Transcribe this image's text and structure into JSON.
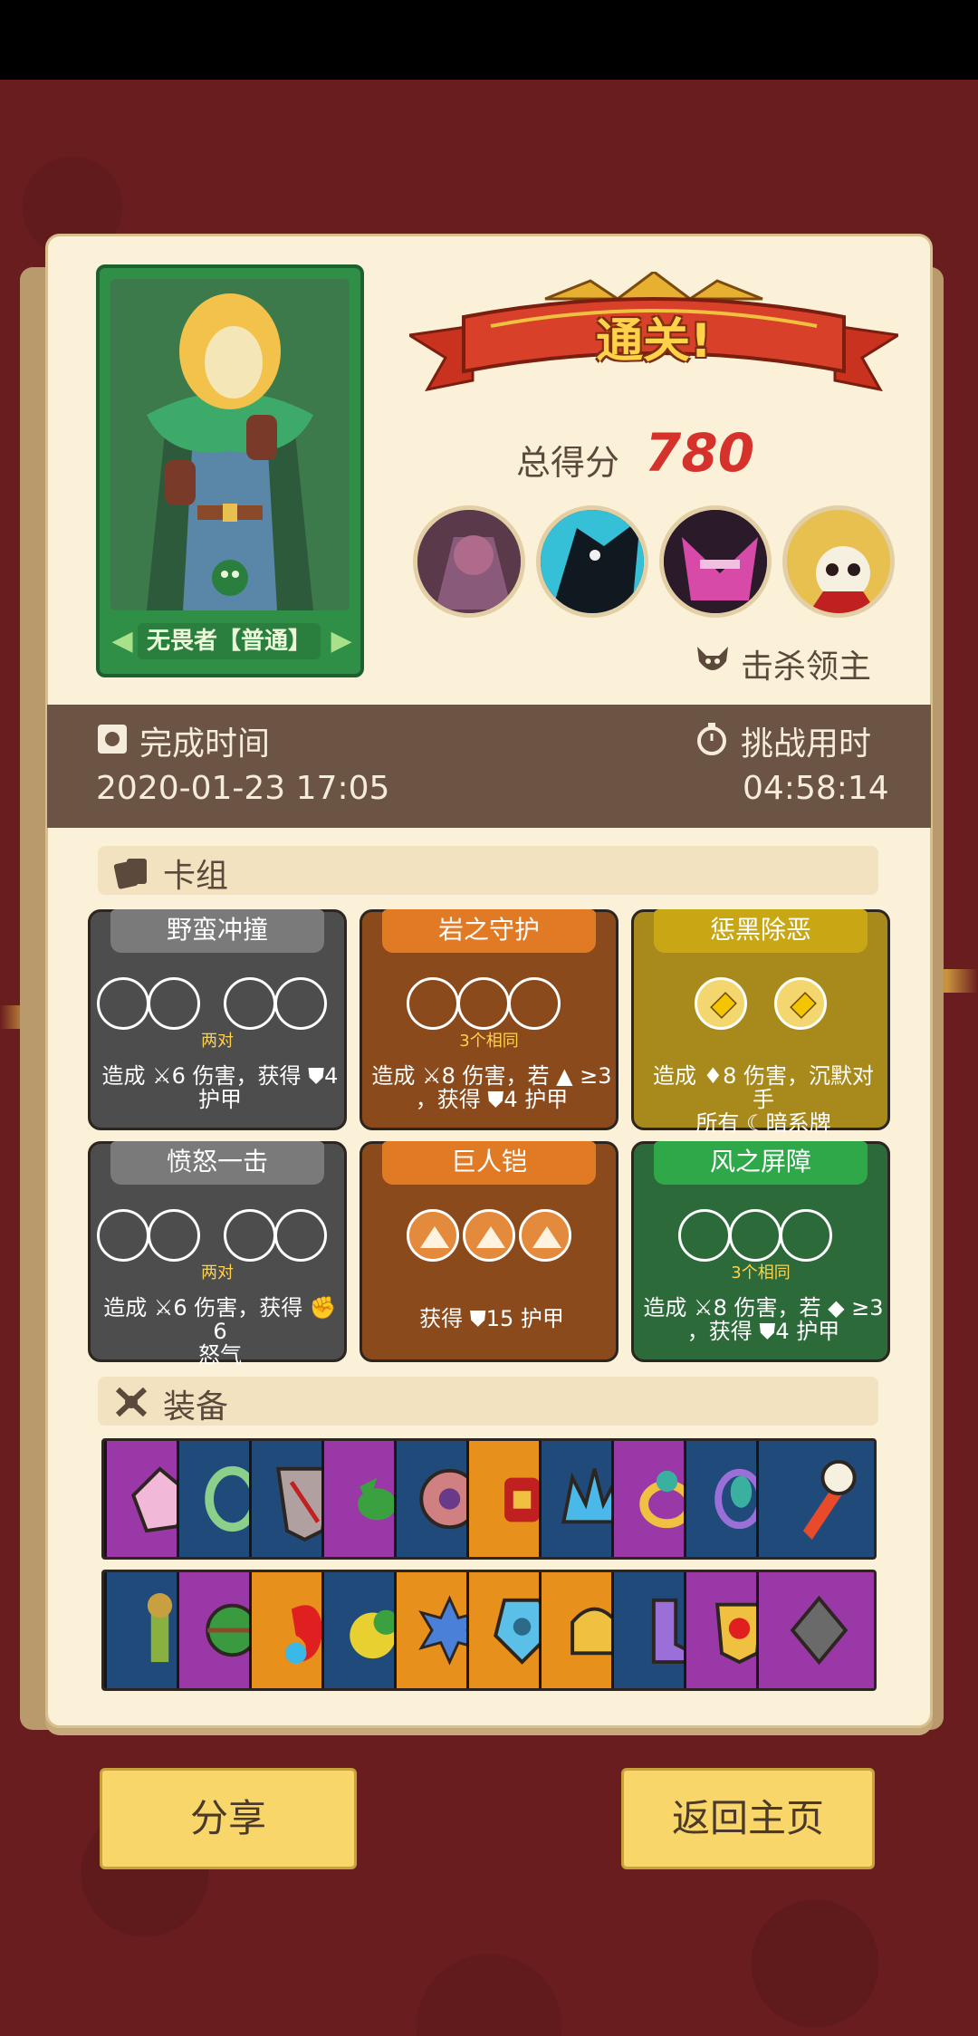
{
  "result": {
    "banner": "通关!",
    "score_label": "总得分",
    "score_value": "780",
    "kill_label": "击杀领主",
    "hero_name": "无畏者【普通】"
  },
  "time": {
    "finish_label": "完成时间",
    "finish_value": "2020-01-23 17:05",
    "duration_label": "挑战用时",
    "duration_value": "04:58:14"
  },
  "deck": {
    "title": "卡组",
    "cards": [
      {
        "name": "野蛮冲撞",
        "sub": "两对",
        "desc1": "造成 ⚔6 伤害，获得 ⛊4",
        "desc2": "护甲"
      },
      {
        "name": "岩之守护",
        "sub": "3个相同",
        "desc1": "造成 ⚔8 伤害，若 ▲ ≥3",
        "desc2": "，获得 ⛊4 护甲"
      },
      {
        "name": "惩黑除恶",
        "sub": "",
        "desc1": "造成 ♦8 伤害，沉默对手",
        "desc2": "所有 ☾暗系牌"
      },
      {
        "name": "愤怒一击",
        "sub": "两对",
        "desc1": "造成 ⚔6 伤害，获得 ✊6",
        "desc2": "怒气"
      },
      {
        "name": "巨人铠",
        "sub": "",
        "desc1": "获得 ⛊15 护甲",
        "desc2": ""
      },
      {
        "name": "风之屏障",
        "sub": "3个相同",
        "desc1": "造成 ⚔8 伤害，若 ◆ ≥3",
        "desc2": "，获得 ⛊4 护甲"
      }
    ]
  },
  "equipment": {
    "title": "装备",
    "row1": [
      "crystal-gem",
      "green-ring",
      "shield-rune",
      "green-bird",
      "round-shield",
      "flame-gauntlet",
      "ice-crown",
      "gold-ring",
      "purple-leaf-ring",
      "skull-rocket"
    ],
    "row2": [
      "scarecrow",
      "green-orb",
      "red-spirit",
      "yellow-moss",
      "spiked-orb",
      "ice-skull",
      "golden-helmet",
      "purple-boot",
      "heart-shield",
      "dark-gem"
    ]
  },
  "buttons": {
    "share": "分享",
    "home": "返回主页"
  },
  "colors": {
    "background": "#6a1d1e",
    "panel": "#fbf1d8",
    "score_red": "#d6322c",
    "gray_card": "#4d4d4d",
    "orange_card": "#8a4a1c",
    "olive_card": "#a88a1c",
    "green_card": "#2d6a3a"
  }
}
